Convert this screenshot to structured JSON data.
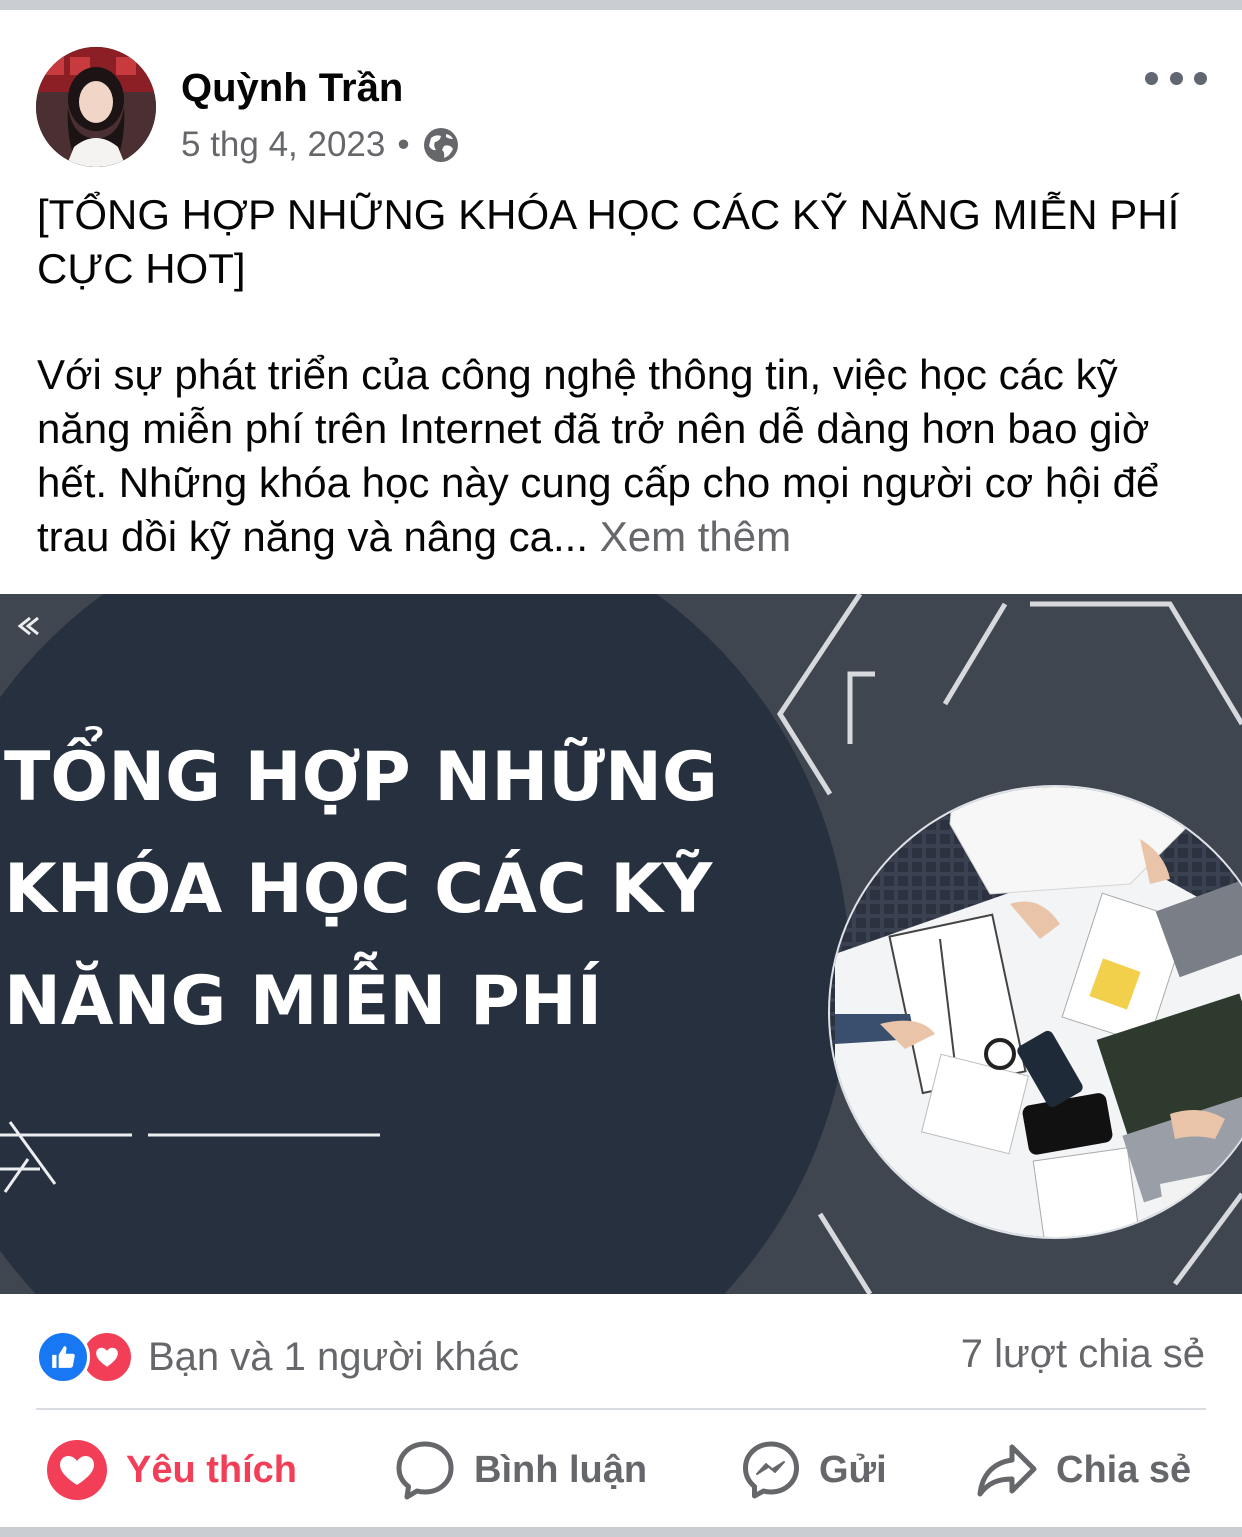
{
  "post": {
    "author": "Quỳnh Trần",
    "date": "5 thg 4, 2023",
    "separator": "•",
    "privacy_icon": "globe-icon",
    "title": "[TỔNG HỢP NHỮNG KHÓA HỌC CÁC KỸ NĂNG MIỄN PHÍ CỰC HOT]",
    "body": "Với sự phát triển của công nghệ thông tin, việc học các kỹ năng miễn phí trên Internet đã trở nên dễ dàng hơn bao giờ hết. Những khóa học này cung cấp cho mọi người cơ hội để trau dồi kỹ năng và nâng ca...",
    "see_more": "Xem thêm"
  },
  "image": {
    "heading_line1": "TỔNG HỢP NHỮNG",
    "heading_line2": "KHÓA HỌC CÁC KỸ",
    "heading_line3": "NĂNG MIỄN PHÍ"
  },
  "reactions": {
    "summary": "Bạn và 1 người khác",
    "shares": "7 lượt chia sẻ",
    "icons": [
      "like-icon",
      "love-icon"
    ]
  },
  "actions": {
    "like": "Yêu thích",
    "comment": "Bình luận",
    "send": "Gửi",
    "share": "Chia sẻ"
  },
  "colors": {
    "love": "#f33e58",
    "like": "#1877f2",
    "muted": "#65676b"
  }
}
